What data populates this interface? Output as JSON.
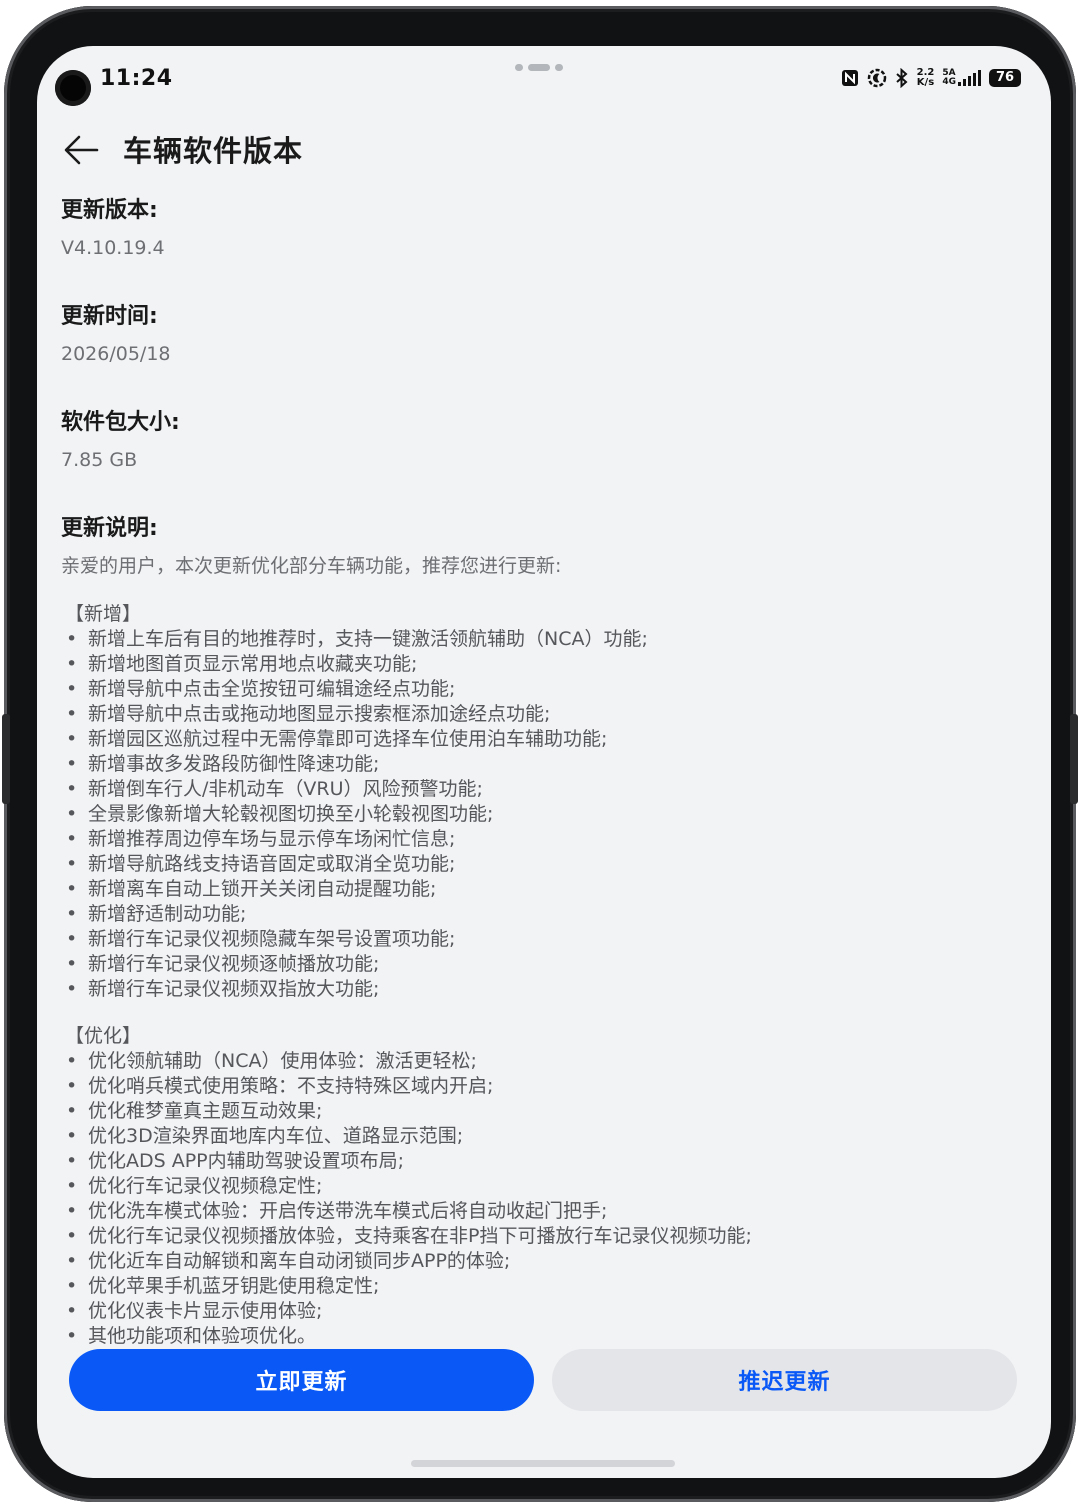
{
  "status_bar": {
    "time": "11:24",
    "net_speed_top": "2.2",
    "net_speed_bottom": "K/s",
    "net_type_top": "5A",
    "net_type_bottom": "4G",
    "battery": "76",
    "icons": [
      "nfc-icon",
      "focus-mode-icon",
      "bluetooth-icon",
      "signal-icon",
      "battery-icon"
    ]
  },
  "header": {
    "title": "车辆软件版本",
    "back_icon": "arrow-left-icon"
  },
  "info": {
    "version_label": "更新版本:",
    "version_value": "V4.10.19.4",
    "time_label": "更新时间:",
    "time_value": "2026/05/18",
    "size_label": "软件包大小:",
    "size_value": "7.85 GB",
    "notes_label": "更新说明:",
    "notes_intro": "亲爱的用户，本次更新优化部分车辆功能，推荐您进行更新:"
  },
  "notes": {
    "new_title": "【新增】",
    "new_items": [
      "新增上车后有目的地推荐时，支持一键激活领航辅助（NCA）功能;",
      "新增地图首页显示常用地点收藏夹功能;",
      "新增导航中点击全览按钮可编辑途经点功能;",
      "新增导航中点击或拖动地图显示搜索框添加途经点功能;",
      "新增园区巡航过程中无需停靠即可选择车位使用泊车辅助功能;",
      "新增事故多发路段防御性降速功能;",
      "新增倒车行人/非机动车（VRU）风险预警功能;",
      "全景影像新增大轮毂视图切换至小轮毂视图功能;",
      "新增推荐周边停车场与显示停车场闲忙信息;",
      "新增导航路线支持语音固定或取消全览功能;",
      "新增离车自动上锁开关关闭自动提醒功能;",
      "新增舒适制动功能;",
      "新增行车记录仪视频隐藏车架号设置项功能;",
      "新增行车记录仪视频逐帧播放功能;",
      "新增行车记录仪视频双指放大功能;"
    ],
    "opt_title": "【优化】",
    "opt_items": [
      "优化领航辅助（NCA）使用体验：激活更轻松;",
      "优化哨兵模式使用策略：不支持特殊区域内开启;",
      "优化稚梦童真主题互动效果;",
      "优化3D渲染界面地库内车位、道路显示范围;",
      "优化ADS APP内辅助驾驶设置项布局;",
      "优化行车记录仪视频稳定性;",
      "优化洗车模式体验：开启传送带洗车模式后将自动收起门把手;",
      "优化行车记录仪视频播放体验，支持乘客在非P挡下可播放行车记录仪视频功能;",
      "优化近车自动解锁和离车自动闭锁同步APP的体验;",
      "优化苹果手机蓝牙钥匙使用稳定性;",
      "优化仪表卡片显示使用体验;",
      "其他功能项和体验项优化。"
    ]
  },
  "actions": {
    "update_now": "立即更新",
    "postpone": "推迟更新"
  },
  "colors": {
    "accent": "#0a59f7",
    "background": "#f1f3f5",
    "secondary_button": "#e3e5e8"
  }
}
